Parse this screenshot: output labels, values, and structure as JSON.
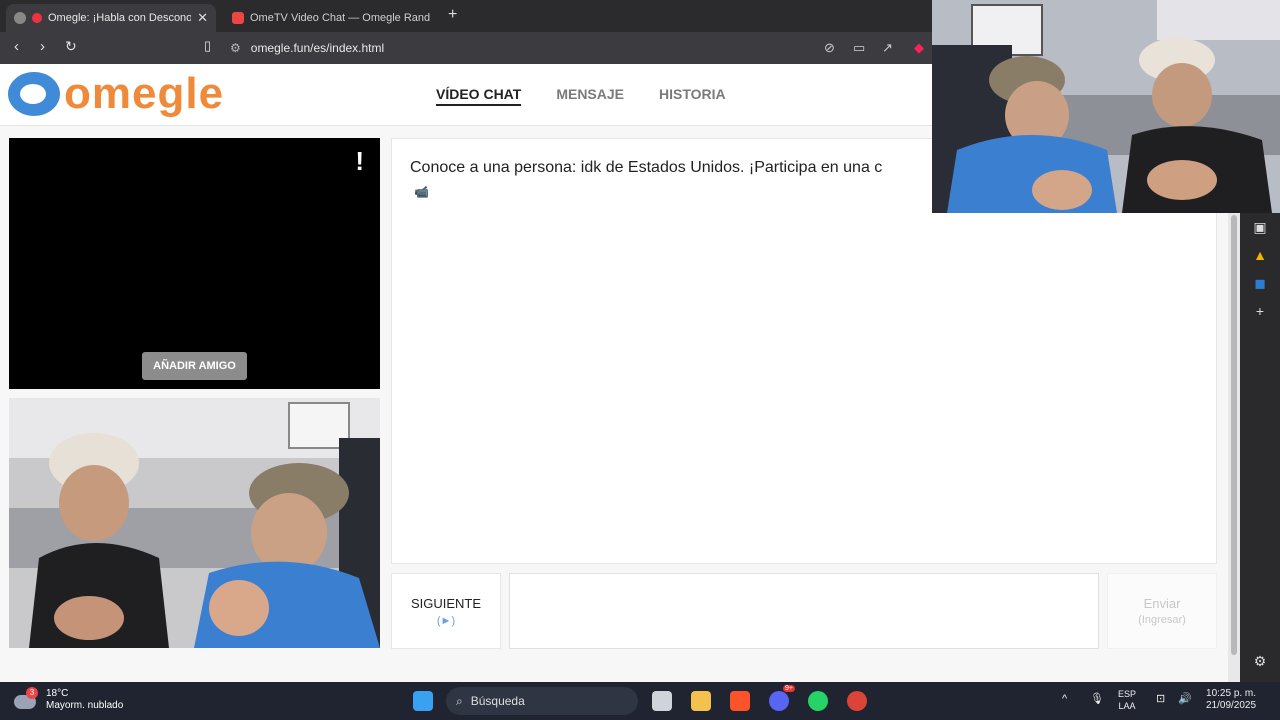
{
  "browser": {
    "tabs": [
      {
        "title": "Omegle: ¡Habla con Desconoc",
        "active": true
      },
      {
        "title": "OmeTV Video Chat — Omegle Rand",
        "active": false
      }
    ],
    "url": "omegle.fun/es/index.html"
  },
  "site": {
    "logo_text": "omegle",
    "nav": [
      {
        "label": "VÍDEO CHAT",
        "active": true
      },
      {
        "label": "MENSAJE",
        "active": false
      },
      {
        "label": "HISTORIA",
        "active": false
      }
    ]
  },
  "stranger_video": {
    "report_label": "!",
    "add_friend_label": "AÑADIR AMIGO"
  },
  "chat": {
    "message": "Conoce a una persona: idk de Estados Unidos. ¡Participa en una c",
    "next_label": "SIGUIENTE",
    "next_sub": "(►)",
    "send_label": "Enviar",
    "send_sub": "(Ingresar)",
    "input_value": ""
  },
  "taskbar": {
    "weather_badge": "3",
    "temperature": "18°C",
    "condition": "Mayorm. nublado",
    "search_placeholder": "Búsqueda",
    "discord_badge": "9+",
    "lang": "ESP",
    "lang_sub": "LAA",
    "time": "10:25 p. m.",
    "date": "21/09/2025"
  },
  "colors": {
    "logo_orange": "#ef8a3a",
    "logo_blue": "#3f8bd8"
  }
}
